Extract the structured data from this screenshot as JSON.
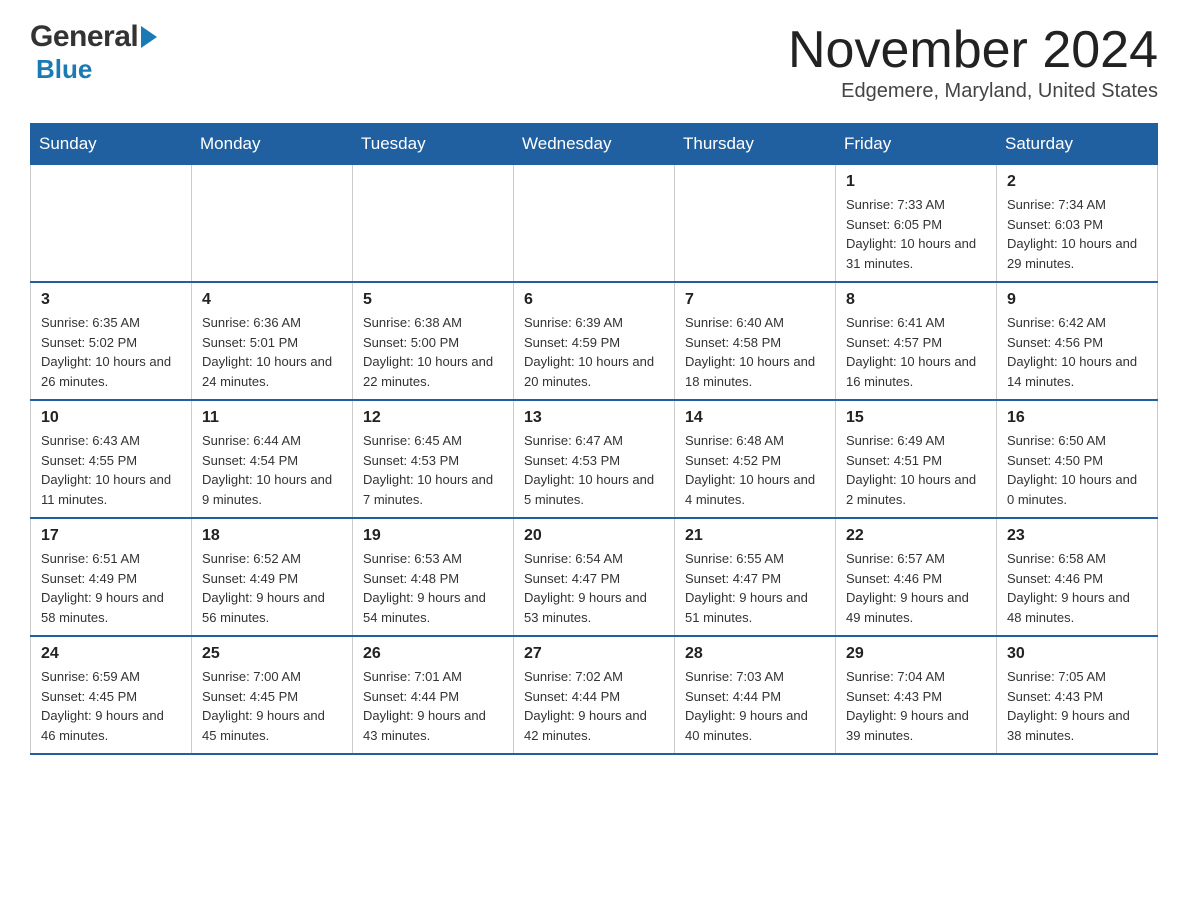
{
  "header": {
    "logo_general": "General",
    "logo_blue": "Blue",
    "month_title": "November 2024",
    "location": "Edgemere, Maryland, United States"
  },
  "weekdays": [
    "Sunday",
    "Monday",
    "Tuesday",
    "Wednesday",
    "Thursday",
    "Friday",
    "Saturday"
  ],
  "weeks": [
    [
      {
        "day": "",
        "sunrise": "",
        "sunset": "",
        "daylight": "",
        "empty": true
      },
      {
        "day": "",
        "sunrise": "",
        "sunset": "",
        "daylight": "",
        "empty": true
      },
      {
        "day": "",
        "sunrise": "",
        "sunset": "",
        "daylight": "",
        "empty": true
      },
      {
        "day": "",
        "sunrise": "",
        "sunset": "",
        "daylight": "",
        "empty": true
      },
      {
        "day": "",
        "sunrise": "",
        "sunset": "",
        "daylight": "",
        "empty": true
      },
      {
        "day": "1",
        "sunrise": "Sunrise: 7:33 AM",
        "sunset": "Sunset: 6:05 PM",
        "daylight": "Daylight: 10 hours and 31 minutes."
      },
      {
        "day": "2",
        "sunrise": "Sunrise: 7:34 AM",
        "sunset": "Sunset: 6:03 PM",
        "daylight": "Daylight: 10 hours and 29 minutes."
      }
    ],
    [
      {
        "day": "3",
        "sunrise": "Sunrise: 6:35 AM",
        "sunset": "Sunset: 5:02 PM",
        "daylight": "Daylight: 10 hours and 26 minutes."
      },
      {
        "day": "4",
        "sunrise": "Sunrise: 6:36 AM",
        "sunset": "Sunset: 5:01 PM",
        "daylight": "Daylight: 10 hours and 24 minutes."
      },
      {
        "day": "5",
        "sunrise": "Sunrise: 6:38 AM",
        "sunset": "Sunset: 5:00 PM",
        "daylight": "Daylight: 10 hours and 22 minutes."
      },
      {
        "day": "6",
        "sunrise": "Sunrise: 6:39 AM",
        "sunset": "Sunset: 4:59 PM",
        "daylight": "Daylight: 10 hours and 20 minutes."
      },
      {
        "day": "7",
        "sunrise": "Sunrise: 6:40 AM",
        "sunset": "Sunset: 4:58 PM",
        "daylight": "Daylight: 10 hours and 18 minutes."
      },
      {
        "day": "8",
        "sunrise": "Sunrise: 6:41 AM",
        "sunset": "Sunset: 4:57 PM",
        "daylight": "Daylight: 10 hours and 16 minutes."
      },
      {
        "day": "9",
        "sunrise": "Sunrise: 6:42 AM",
        "sunset": "Sunset: 4:56 PM",
        "daylight": "Daylight: 10 hours and 14 minutes."
      }
    ],
    [
      {
        "day": "10",
        "sunrise": "Sunrise: 6:43 AM",
        "sunset": "Sunset: 4:55 PM",
        "daylight": "Daylight: 10 hours and 11 minutes."
      },
      {
        "day": "11",
        "sunrise": "Sunrise: 6:44 AM",
        "sunset": "Sunset: 4:54 PM",
        "daylight": "Daylight: 10 hours and 9 minutes."
      },
      {
        "day": "12",
        "sunrise": "Sunrise: 6:45 AM",
        "sunset": "Sunset: 4:53 PM",
        "daylight": "Daylight: 10 hours and 7 minutes."
      },
      {
        "day": "13",
        "sunrise": "Sunrise: 6:47 AM",
        "sunset": "Sunset: 4:53 PM",
        "daylight": "Daylight: 10 hours and 5 minutes."
      },
      {
        "day": "14",
        "sunrise": "Sunrise: 6:48 AM",
        "sunset": "Sunset: 4:52 PM",
        "daylight": "Daylight: 10 hours and 4 minutes."
      },
      {
        "day": "15",
        "sunrise": "Sunrise: 6:49 AM",
        "sunset": "Sunset: 4:51 PM",
        "daylight": "Daylight: 10 hours and 2 minutes."
      },
      {
        "day": "16",
        "sunrise": "Sunrise: 6:50 AM",
        "sunset": "Sunset: 4:50 PM",
        "daylight": "Daylight: 10 hours and 0 minutes."
      }
    ],
    [
      {
        "day": "17",
        "sunrise": "Sunrise: 6:51 AM",
        "sunset": "Sunset: 4:49 PM",
        "daylight": "Daylight: 9 hours and 58 minutes."
      },
      {
        "day": "18",
        "sunrise": "Sunrise: 6:52 AM",
        "sunset": "Sunset: 4:49 PM",
        "daylight": "Daylight: 9 hours and 56 minutes."
      },
      {
        "day": "19",
        "sunrise": "Sunrise: 6:53 AM",
        "sunset": "Sunset: 4:48 PM",
        "daylight": "Daylight: 9 hours and 54 minutes."
      },
      {
        "day": "20",
        "sunrise": "Sunrise: 6:54 AM",
        "sunset": "Sunset: 4:47 PM",
        "daylight": "Daylight: 9 hours and 53 minutes."
      },
      {
        "day": "21",
        "sunrise": "Sunrise: 6:55 AM",
        "sunset": "Sunset: 4:47 PM",
        "daylight": "Daylight: 9 hours and 51 minutes."
      },
      {
        "day": "22",
        "sunrise": "Sunrise: 6:57 AM",
        "sunset": "Sunset: 4:46 PM",
        "daylight": "Daylight: 9 hours and 49 minutes."
      },
      {
        "day": "23",
        "sunrise": "Sunrise: 6:58 AM",
        "sunset": "Sunset: 4:46 PM",
        "daylight": "Daylight: 9 hours and 48 minutes."
      }
    ],
    [
      {
        "day": "24",
        "sunrise": "Sunrise: 6:59 AM",
        "sunset": "Sunset: 4:45 PM",
        "daylight": "Daylight: 9 hours and 46 minutes."
      },
      {
        "day": "25",
        "sunrise": "Sunrise: 7:00 AM",
        "sunset": "Sunset: 4:45 PM",
        "daylight": "Daylight: 9 hours and 45 minutes."
      },
      {
        "day": "26",
        "sunrise": "Sunrise: 7:01 AM",
        "sunset": "Sunset: 4:44 PM",
        "daylight": "Daylight: 9 hours and 43 minutes."
      },
      {
        "day": "27",
        "sunrise": "Sunrise: 7:02 AM",
        "sunset": "Sunset: 4:44 PM",
        "daylight": "Daylight: 9 hours and 42 minutes."
      },
      {
        "day": "28",
        "sunrise": "Sunrise: 7:03 AM",
        "sunset": "Sunset: 4:44 PM",
        "daylight": "Daylight: 9 hours and 40 minutes."
      },
      {
        "day": "29",
        "sunrise": "Sunrise: 7:04 AM",
        "sunset": "Sunset: 4:43 PM",
        "daylight": "Daylight: 9 hours and 39 minutes."
      },
      {
        "day": "30",
        "sunrise": "Sunrise: 7:05 AM",
        "sunset": "Sunset: 4:43 PM",
        "daylight": "Daylight: 9 hours and 38 minutes."
      }
    ]
  ]
}
